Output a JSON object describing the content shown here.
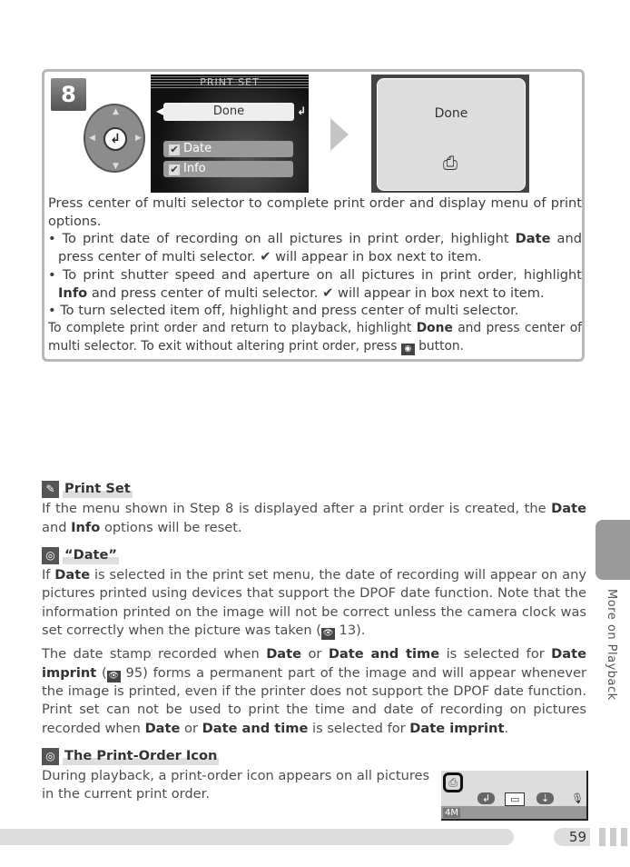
{
  "step": {
    "number": "8",
    "screen1": {
      "title": "PRINT SET",
      "selected": "Done",
      "options": [
        {
          "label": "Date",
          "checked": true
        },
        {
          "label": "Info",
          "checked": true
        }
      ]
    },
    "screen2": {
      "label": "Done",
      "icon": "print-order-icon"
    },
    "paragraphs": [
      {
        "cls": "",
        "segs": [
          {
            "t": "Press center of multi selector to complete print order and display menu of print options."
          }
        ]
      },
      {
        "cls": "bul",
        "segs": [
          {
            "t": "• To print date of recording on all pictures in print order, highlight "
          },
          {
            "t": "Date",
            "b": true
          },
          {
            "t": " and press center of multi selector.  ✔ will appear in box next to item."
          }
        ]
      },
      {
        "cls": "bul",
        "segs": [
          {
            "t": "• To print shutter speed and aperture on all pictures in print order, highlight "
          },
          {
            "t": "Info",
            "b": true
          },
          {
            "t": " and press center of multi selector.  ✔ will appear in box next to item."
          }
        ]
      },
      {
        "cls": "bul",
        "segs": [
          {
            "t": "• To turn selected item off, highlight and press center of multi selector."
          }
        ]
      },
      {
        "cls": "sm",
        "segs": [
          {
            "t": "To complete print order and return to playback, highlight "
          },
          {
            "t": "Done",
            "b": true
          },
          {
            "t": " and press center of multi selector.  To exit without altering print order, press "
          },
          {
            "icon": "menu-button-icon"
          },
          {
            "t": " button."
          }
        ]
      }
    ]
  },
  "notes": [
    {
      "title": "Print Set",
      "icon": "paperclip-icon",
      "paragraphs": [
        {
          "segs": [
            {
              "t": "If the menu shown in Step 8 is displayed after a print order is created, the "
            },
            {
              "t": "Date",
              "b": true
            },
            {
              "t": " and "
            },
            {
              "t": "Info",
              "b": true
            },
            {
              "t": " options will be reset."
            }
          ]
        }
      ]
    },
    {
      "title": "“Date”",
      "icon": "magnifier-icon",
      "paragraphs": [
        {
          "segs": [
            {
              "t": "If "
            },
            {
              "t": "Date",
              "b": true
            },
            {
              "t": " is selected in the print set menu, the date of recording will appear on any pictures printed using devices that support the DPOF date function.  Note that the information printed on the image will not be correct unless the camera clock was set correctly when the picture was taken ("
            },
            {
              "icon": "page-ref-icon"
            },
            {
              "t": " 13)."
            }
          ]
        },
        {
          "segs": [
            {
              "t": "The date stamp recorded when "
            },
            {
              "t": "Date",
              "b": true
            },
            {
              "t": " or "
            },
            {
              "t": "Date and time",
              "b": true
            },
            {
              "t": " is selected for "
            },
            {
              "t": "Date imprint",
              "b": true
            },
            {
              "t": " ("
            },
            {
              "icon": "page-ref-icon"
            },
            {
              "t": " 95) forms a permanent part of the image and will appear whenever the image is printed, even if the printer does not support the DPOF date function.  Print set can not be used to print the time and date of recording on pictures recorded when "
            },
            {
              "t": "Date",
              "b": true
            },
            {
              "t": " or "
            },
            {
              "t": "Date and time",
              "b": true
            },
            {
              "t": " is selected for "
            },
            {
              "t": "Date imprint",
              "b": true
            },
            {
              "t": "."
            }
          ]
        }
      ]
    },
    {
      "title": "The Print-Order Icon",
      "icon": "magnifier-icon",
      "paragraphs": [
        {
          "segs": [
            {
              "t": "During playback, a print-order icon appears on all pictures in the current print order."
            }
          ]
        }
      ]
    }
  ],
  "camera_display": {
    "size_label": "4M",
    "icons": [
      "print-order-icon",
      "enter-icon",
      "zoom-icon",
      "transfer-icon",
      "microphone-icon"
    ]
  },
  "page_number": "59",
  "side_tab": "More on Playback"
}
